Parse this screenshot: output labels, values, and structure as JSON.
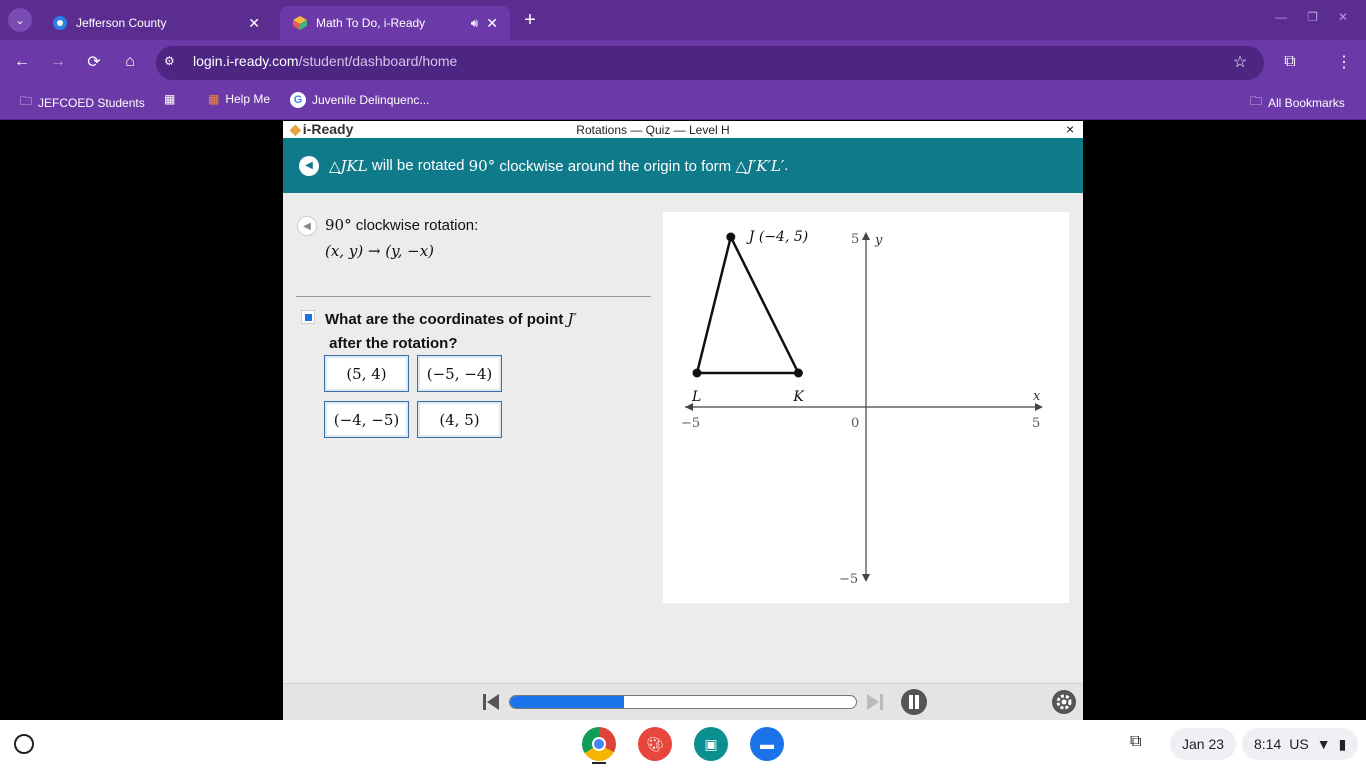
{
  "browser": {
    "tabs": [
      {
        "title": "Jefferson County",
        "icon": "jefferson-county-icon",
        "active": false
      },
      {
        "title": "Math To Do, i-Ready",
        "icon": "iready-cube-icon",
        "active": true
      }
    ],
    "url_host": "login.i-ready.com",
    "url_path": "/student/dashboard/home",
    "bookmarks": [
      {
        "label": "JEFCOED Students",
        "icon": "folder-icon"
      },
      {
        "label": "Help Me",
        "icon": "grid-icon"
      },
      {
        "label": "Juvenile Delinquenc...",
        "icon": "google-icon"
      }
    ],
    "all_bookmarks": "All Bookmarks"
  },
  "quiz": {
    "logo": "i-Ready",
    "title": "Rotations — Quiz — Level H",
    "close": "×",
    "banner_pre": "△",
    "banner_tri": "JKL",
    "banner_mid": " will be rotated ",
    "banner_angle": "90°",
    "banner_post": " clockwise around the origin to form △",
    "banner_tri2": "J′K′L′",
    "banner_end": ".",
    "hint_line1_num": "90°",
    "hint_line1_text": " clockwise rotation:",
    "hint_line2": "(x, y) → (y, −x)",
    "question_text": "What are the coordinates of point ",
    "question_point": "J′",
    "question_text2": " after the rotation?",
    "choices": [
      "(5, 4)",
      "(−5, −4)",
      "(−4, −5)",
      "(4, 5)"
    ]
  },
  "graph": {
    "points": [
      {
        "name": "J",
        "label": "J (−4, 5)",
        "x": -4,
        "y": 5
      },
      {
        "name": "K",
        "label": "K",
        "x": -2,
        "y": 1
      },
      {
        "name": "L",
        "label": "L",
        "x": -5,
        "y": 1
      }
    ],
    "x_axis_label": "x",
    "y_axis_label": "y",
    "ticks": {
      "x_min": "−5",
      "x_zero": "0",
      "x_max": "5",
      "y_max": "5",
      "y_min": "−5"
    },
    "xlim": [
      -5,
      5
    ],
    "ylim": [
      -5,
      5
    ]
  },
  "media": {
    "progress": 0.33
  },
  "shelf": {
    "date": "Jan 23",
    "time": "8:14",
    "locale": "US"
  }
}
